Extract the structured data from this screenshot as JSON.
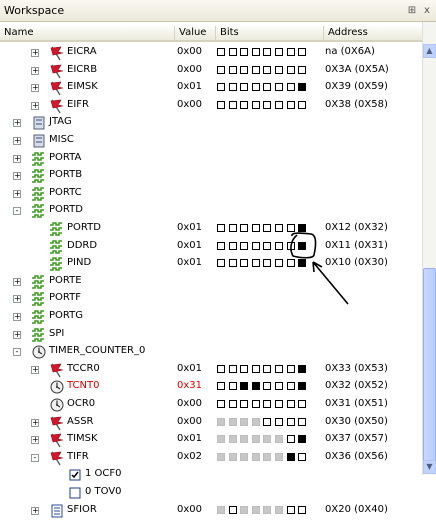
{
  "window": {
    "title": "Workspace",
    "pin_label": "⊞",
    "close_label": "x"
  },
  "columns": {
    "name": "Name",
    "value": "Value",
    "bits": "Bits",
    "address": "Address"
  },
  "rows": [
    {
      "name": "EICRA",
      "level": 3,
      "icon": "flag",
      "value": "0x00",
      "bits": "00000000",
      "address": "na (0X6A)",
      "exp": "+"
    },
    {
      "name": "EICRB",
      "level": 3,
      "icon": "flag",
      "value": "0x00",
      "bits": "00000000",
      "address": "0X3A (0X5A)",
      "exp": "+"
    },
    {
      "name": "EIMSK",
      "level": 3,
      "icon": "flag",
      "value": "0x01",
      "bits": "00000001",
      "address": "0X39 (0X59)",
      "exp": "+"
    },
    {
      "name": "EIFR",
      "level": 3,
      "icon": "flag",
      "value": "0x00",
      "bits": "00000000",
      "address": "0X38 (0X58)",
      "exp": "+"
    },
    {
      "name": "JTAG",
      "level": 2,
      "icon": "module",
      "value": "",
      "bits": "",
      "address": "",
      "exp": "+"
    },
    {
      "name": "MISC",
      "level": 2,
      "icon": "module",
      "value": "",
      "bits": "",
      "address": "",
      "exp": "+"
    },
    {
      "name": "PORTA",
      "level": 2,
      "icon": "port",
      "value": "",
      "bits": "",
      "address": "",
      "exp": "+"
    },
    {
      "name": "PORTB",
      "level": 2,
      "icon": "port",
      "value": "",
      "bits": "",
      "address": "",
      "exp": "+"
    },
    {
      "name": "PORTC",
      "level": 2,
      "icon": "port",
      "value": "",
      "bits": "",
      "address": "",
      "exp": "+"
    },
    {
      "name": "PORTD",
      "level": 2,
      "icon": "port",
      "value": "",
      "bits": "",
      "address": "",
      "exp": "-"
    },
    {
      "name": "PORTD",
      "level": 3,
      "icon": "port",
      "value": "0x01",
      "bits": "00000001",
      "address": "0X12 (0X32)",
      "exp": ""
    },
    {
      "name": "DDRD",
      "level": 3,
      "icon": "port",
      "value": "0x01",
      "bits": "00000001",
      "address": "0X11 (0X31)",
      "exp": ""
    },
    {
      "name": "PIND",
      "level": 3,
      "icon": "port",
      "value": "0x01",
      "bits": "00000001",
      "address": "0X10 (0X30)",
      "exp": ""
    },
    {
      "name": "PORTE",
      "level": 2,
      "icon": "port",
      "value": "",
      "bits": "",
      "address": "",
      "exp": "+"
    },
    {
      "name": "PORTF",
      "level": 2,
      "icon": "port",
      "value": "",
      "bits": "",
      "address": "",
      "exp": "+"
    },
    {
      "name": "PORTG",
      "level": 2,
      "icon": "port",
      "value": "",
      "bits": "",
      "address": "",
      "exp": "+"
    },
    {
      "name": "SPI",
      "level": 2,
      "icon": "port",
      "value": "",
      "bits": "",
      "address": "",
      "exp": "+"
    },
    {
      "name": "TIMER_COUNTER_0",
      "level": 2,
      "icon": "clock",
      "value": "",
      "bits": "",
      "address": "",
      "exp": "-"
    },
    {
      "name": "TCCR0",
      "level": 3,
      "icon": "flag",
      "value": "0x01",
      "bits": "00000001",
      "address": "0X33 (0X53)",
      "exp": "+"
    },
    {
      "name": "TCNT0",
      "level": 3,
      "icon": "clock",
      "value": "0x31",
      "bits": "00110001",
      "address": "0X32 (0X52)",
      "exp": "",
      "red": true
    },
    {
      "name": "OCR0",
      "level": 3,
      "icon": "clock",
      "value": "0x00",
      "bits": "00000000",
      "address": "0X31 (0X51)",
      "exp": ""
    },
    {
      "name": "ASSR",
      "level": 3,
      "icon": "flag",
      "value": "0x00",
      "bits": "xxxx0000",
      "address": "0X30 (0X50)",
      "exp": "+"
    },
    {
      "name": "TIMSK",
      "level": 3,
      "icon": "flag",
      "value": "0x01",
      "bits": "xxxxxx01",
      "address": "0X37 (0X57)",
      "exp": "+"
    },
    {
      "name": "TIFR",
      "level": 3,
      "icon": "flag",
      "value": "0x02",
      "bits": "xxxxxx10",
      "address": "0X36 (0X56)",
      "exp": "-"
    },
    {
      "name": "1 OCF0",
      "level": 4,
      "icon": "check-on",
      "value": "",
      "bits": "",
      "address": "",
      "exp": ""
    },
    {
      "name": "0 TOV0",
      "level": 4,
      "icon": "check-off",
      "value": "",
      "bits": "",
      "address": "",
      "exp": ""
    },
    {
      "name": "SFIOR",
      "level": 3,
      "icon": "doc",
      "value": "0x00",
      "bits": "x0xxxx00",
      "address": "0X20 (0X40)",
      "exp": "+"
    }
  ],
  "annotation": {
    "description": "hand-drawn circle around PIND bit 0 with arrow"
  }
}
